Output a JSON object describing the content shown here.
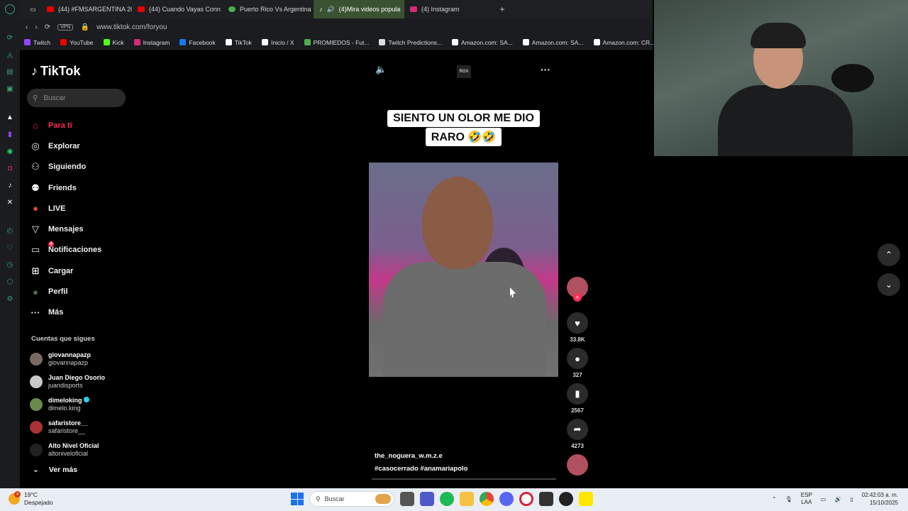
{
  "browser": {
    "tabs": [
      {
        "label": "(44) #FMSARGENTINA 20",
        "color": "#e00"
      },
      {
        "label": "(44) Cuando Vayas Conn",
        "color": "#e00"
      },
      {
        "label": "Puerto Rico Vs Argentina",
        "color": "#4caf50"
      },
      {
        "label": "(4)Mira videos popula",
        "color": "#fff",
        "active": true
      },
      {
        "label": "(4) Instagram",
        "color": "#d62976"
      }
    ],
    "url": "www.tiktok.com/foryou",
    "vpn_label": "VPN",
    "bookmarks": [
      {
        "label": "Twitch",
        "color": "#9146ff"
      },
      {
        "label": "YouTube",
        "color": "#e00"
      },
      {
        "label": "Kick",
        "color": "#53fc18"
      },
      {
        "label": "Instagram",
        "color": "#d62976"
      },
      {
        "label": "Facebook",
        "color": "#1877f2"
      },
      {
        "label": "TikTok",
        "color": "#fff"
      },
      {
        "label": "Inicio / X",
        "color": "#fff"
      },
      {
        "label": "PROMIEDOS - Fut...",
        "color": "#4caf50"
      },
      {
        "label": "Twitch Predictions...",
        "color": "#ddd"
      },
      {
        "label": "Amazon.com: SA...",
        "color": "#fff"
      },
      {
        "label": "Amazon.com: SA...",
        "color": "#fff"
      },
      {
        "label": "Amazon.com: CR...",
        "color": "#fff"
      }
    ]
  },
  "tiktok": {
    "brand": "TikTok",
    "search_placeholder": "Buscar",
    "nav": [
      {
        "label": "Para ti",
        "icon": "home-icon",
        "glyph": "⌂",
        "active": true
      },
      {
        "label": "Explorar",
        "icon": "compass-icon",
        "glyph": "◎"
      },
      {
        "label": "Siguiendo",
        "icon": "following-icon",
        "glyph": "⚇"
      },
      {
        "label": "Friends",
        "icon": "friends-icon",
        "glyph": "⚉"
      },
      {
        "label": "LIVE",
        "icon": "live-icon",
        "glyph": "●"
      },
      {
        "label": "Mensajes",
        "icon": "messages-icon",
        "glyph": "▽"
      },
      {
        "label": "Notificaciones",
        "icon": "notifications-icon",
        "glyph": "▭",
        "badge": "4"
      },
      {
        "label": "Cargar",
        "icon": "upload-icon",
        "glyph": "⊞"
      },
      {
        "label": "Perfil",
        "icon": "profile-icon",
        "glyph": "●"
      },
      {
        "label": "Más",
        "icon": "more-icon",
        "glyph": "···"
      }
    ],
    "following_title": "Cuentas que sigues",
    "following": [
      {
        "name": "giovannapazp",
        "handle": "giovannapazp",
        "color": "#7a6a60"
      },
      {
        "name": "Juan Diego Osorio",
        "handle": "juandisports",
        "color": "#c9c9c9"
      },
      {
        "name": "dimeloking",
        "handle": "dimelo.king",
        "color": "#6a8a4a",
        "verified": true
      },
      {
        "name": "safaristore__",
        "handle": "safaristore__",
        "color": "#a33"
      },
      {
        "name": "Alto Nivel Oficial",
        "handle": "altoniveloficial",
        "color": "#222"
      }
    ],
    "see_more": "Ver más",
    "video": {
      "caption_line1": "SIENTO UN OLOR ME DIO",
      "caption_line2": "RARO 🤣🤣",
      "channel_mark": "RGX",
      "username": "the_noguera_w.m.z.e",
      "hashtags": "#casocerrado  #anamariapolo",
      "likes": "33.8K",
      "comments": "327",
      "saves": "2567",
      "shares": "4273"
    }
  },
  "taskbar": {
    "temperature": "19°C",
    "weather": "Despejado",
    "weather_badge": "4",
    "search": "Buscar",
    "lang1": "ESP",
    "lang2": "LAA",
    "time": "02:42:03 a. m.",
    "date": "15/10/2025"
  }
}
